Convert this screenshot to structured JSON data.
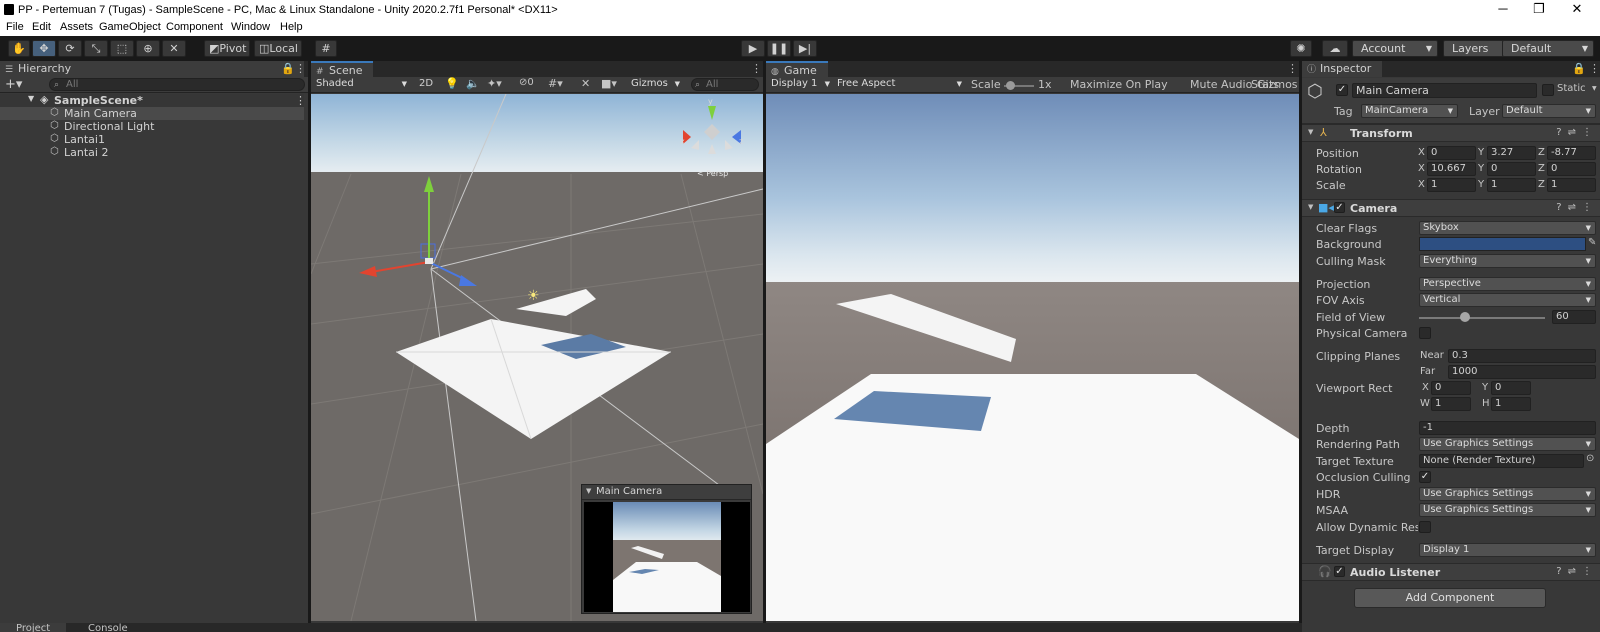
{
  "window": {
    "title": "PP - Pertemuan 7 (Tugas) - SampleScene - PC, Mac & Linux Standalone - Unity 2020.2.7f1 Personal* <DX11>",
    "minimize": "─",
    "maximize": "❐",
    "close": "✕"
  },
  "menu": [
    "File",
    "Edit",
    "Assets",
    "GameObject",
    "Component",
    "Window",
    "Help"
  ],
  "toolbar": {
    "pivot": "Pivot",
    "local": "Local",
    "account": "Account",
    "layers": "Layers",
    "layout": "Default"
  },
  "hierarchy": {
    "tab": "Hierarchy",
    "search_placeholder": "All",
    "scene": "SampleScene*",
    "items": [
      "Main Camera",
      "Directional Light",
      "Lantai1",
      "Lantai 2"
    ]
  },
  "scene_view": {
    "tab": "Scene",
    "shading": "Shaded",
    "mode_2d": "2D",
    "hidden_count": "0",
    "gizmos": "Gizmos",
    "search_placeholder": "All",
    "axis_y": "y",
    "axis_x": "x",
    "axis_z": "z",
    "persp": "< Persp",
    "camera_preview_title": "Main Camera"
  },
  "game_view": {
    "tab": "Game",
    "display": "Display 1",
    "aspect": "Free Aspect",
    "scale_label": "Scale",
    "scale_value": "1x",
    "maximize": "Maximize On Play",
    "mute": "Mute Audio",
    "stats": "Stats",
    "gizmos": "Gizmos"
  },
  "inspector": {
    "tab": "Inspector",
    "object_name": "Main Camera",
    "static": "Static",
    "tag_label": "Tag",
    "tag": "MainCamera",
    "layer_label": "Layer",
    "layer": "Default",
    "transform": {
      "title": "Transform",
      "position_label": "Position",
      "rotation_label": "Rotation",
      "scale_label": "Scale",
      "position": {
        "x": "0",
        "y": "3.27",
        "z": "-8.77"
      },
      "rotation": {
        "x": "10.667",
        "y": "0",
        "z": "0"
      },
      "scale": {
        "x": "1",
        "y": "1",
        "z": "1"
      }
    },
    "camera": {
      "title": "Camera",
      "clear_flags_label": "Clear Flags",
      "clear_flags": "Skybox",
      "background_label": "Background",
      "background_color": "#2d4f82",
      "culling_mask_label": "Culling Mask",
      "culling_mask": "Everything",
      "projection_label": "Projection",
      "projection": "Perspective",
      "fov_axis_label": "FOV Axis",
      "fov_axis": "Vertical",
      "fov_label": "Field of View",
      "fov": "60",
      "physical_label": "Physical Camera",
      "clipping_label": "Clipping Planes",
      "near_label": "Near",
      "near": "0.3",
      "far_label": "Far",
      "far": "1000",
      "viewport_label": "Viewport Rect",
      "vp_x": "0",
      "vp_y": "0",
      "vp_w": "1",
      "vp_h": "1",
      "depth_label": "Depth",
      "depth": "-1",
      "rendering_path_label": "Rendering Path",
      "rendering_path": "Use Graphics Settings",
      "target_texture_label": "Target Texture",
      "target_texture": "None (Render Texture)",
      "occlusion_label": "Occlusion Culling",
      "hdr_label": "HDR",
      "hdr": "Use Graphics Settings",
      "msaa_label": "MSAA",
      "msaa": "Use Graphics Settings",
      "dynamic_label": "Allow Dynamic Resolu",
      "target_display_label": "Target Display",
      "target_display": "Display 1"
    },
    "audio_listener": "Audio Listener",
    "add_component": "Add Component"
  },
  "bottom_tabs": [
    "Project",
    "Console"
  ]
}
